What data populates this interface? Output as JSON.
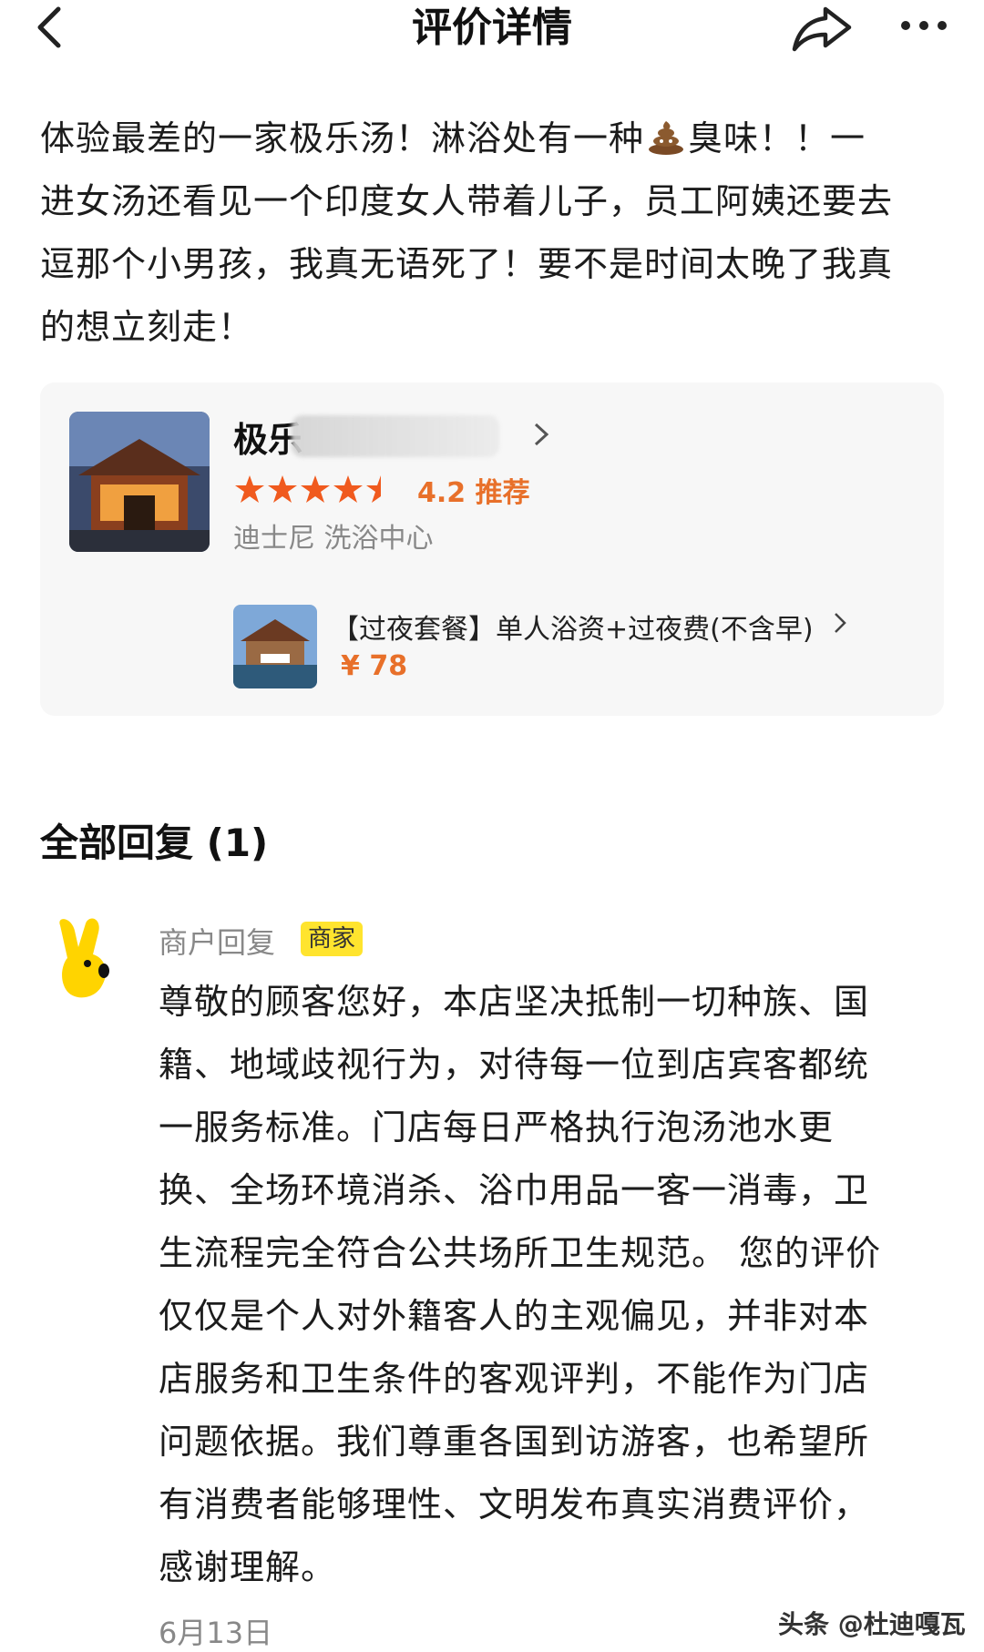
{
  "header": {
    "title": "评价详情"
  },
  "review": {
    "lines": [
      "体验最差的一家极乐汤！淋浴处有一种",
      "臭味！！一",
      "进女汤还看见一个印度女人带着儿子，员工阿姨还要去",
      "逗那个小男孩，我真无语死了！要不是时间太晚了我真",
      "的想立刻走！"
    ]
  },
  "shop": {
    "name_visible": "极乐",
    "rating": "4.2 推荐",
    "stars": 4.5,
    "tags": "迪士尼 洗浴中心",
    "deal": {
      "title": "【过夜套餐】单人浴资+过夜费(不含早)",
      "price": "¥ 78"
    }
  },
  "replies": {
    "header": "全部回复 (1)",
    "items": [
      {
        "author": "商户回复",
        "badge": "商家",
        "lines": [
          "尊敬的顾客您好，本店坚决抵制一切种族、国",
          "籍、地域歧视行为，对待每一位到店宾客都统",
          "一服务标准。门店每日严格执行泡汤池水更",
          "换、全场环境消杀、浴巾用品一客一消毒，卫",
          "生流程完全符合公共场所卫生规范。 您的评价",
          "仅仅是个人对外籍客人的主观偏见，并非对本",
          "店服务和卫生条件的客观评判，不能作为门店",
          "问题依据。我们尊重各国到访游客，也希望所",
          "有消费者能够理性、文明发布真实消费评价，",
          "感谢理解。"
        ],
        "date": "6月13日"
      }
    ]
  },
  "watermark": "头条 @杜迪嘎瓦",
  "colors": {
    "accent": "#e8702a",
    "badge": "#ffe42e",
    "muted": "#888888"
  },
  "icons": [
    "back-arrow-icon",
    "share-icon",
    "more-icon",
    "poo-emoji-icon",
    "star-icon",
    "chevron-right-icon"
  ]
}
